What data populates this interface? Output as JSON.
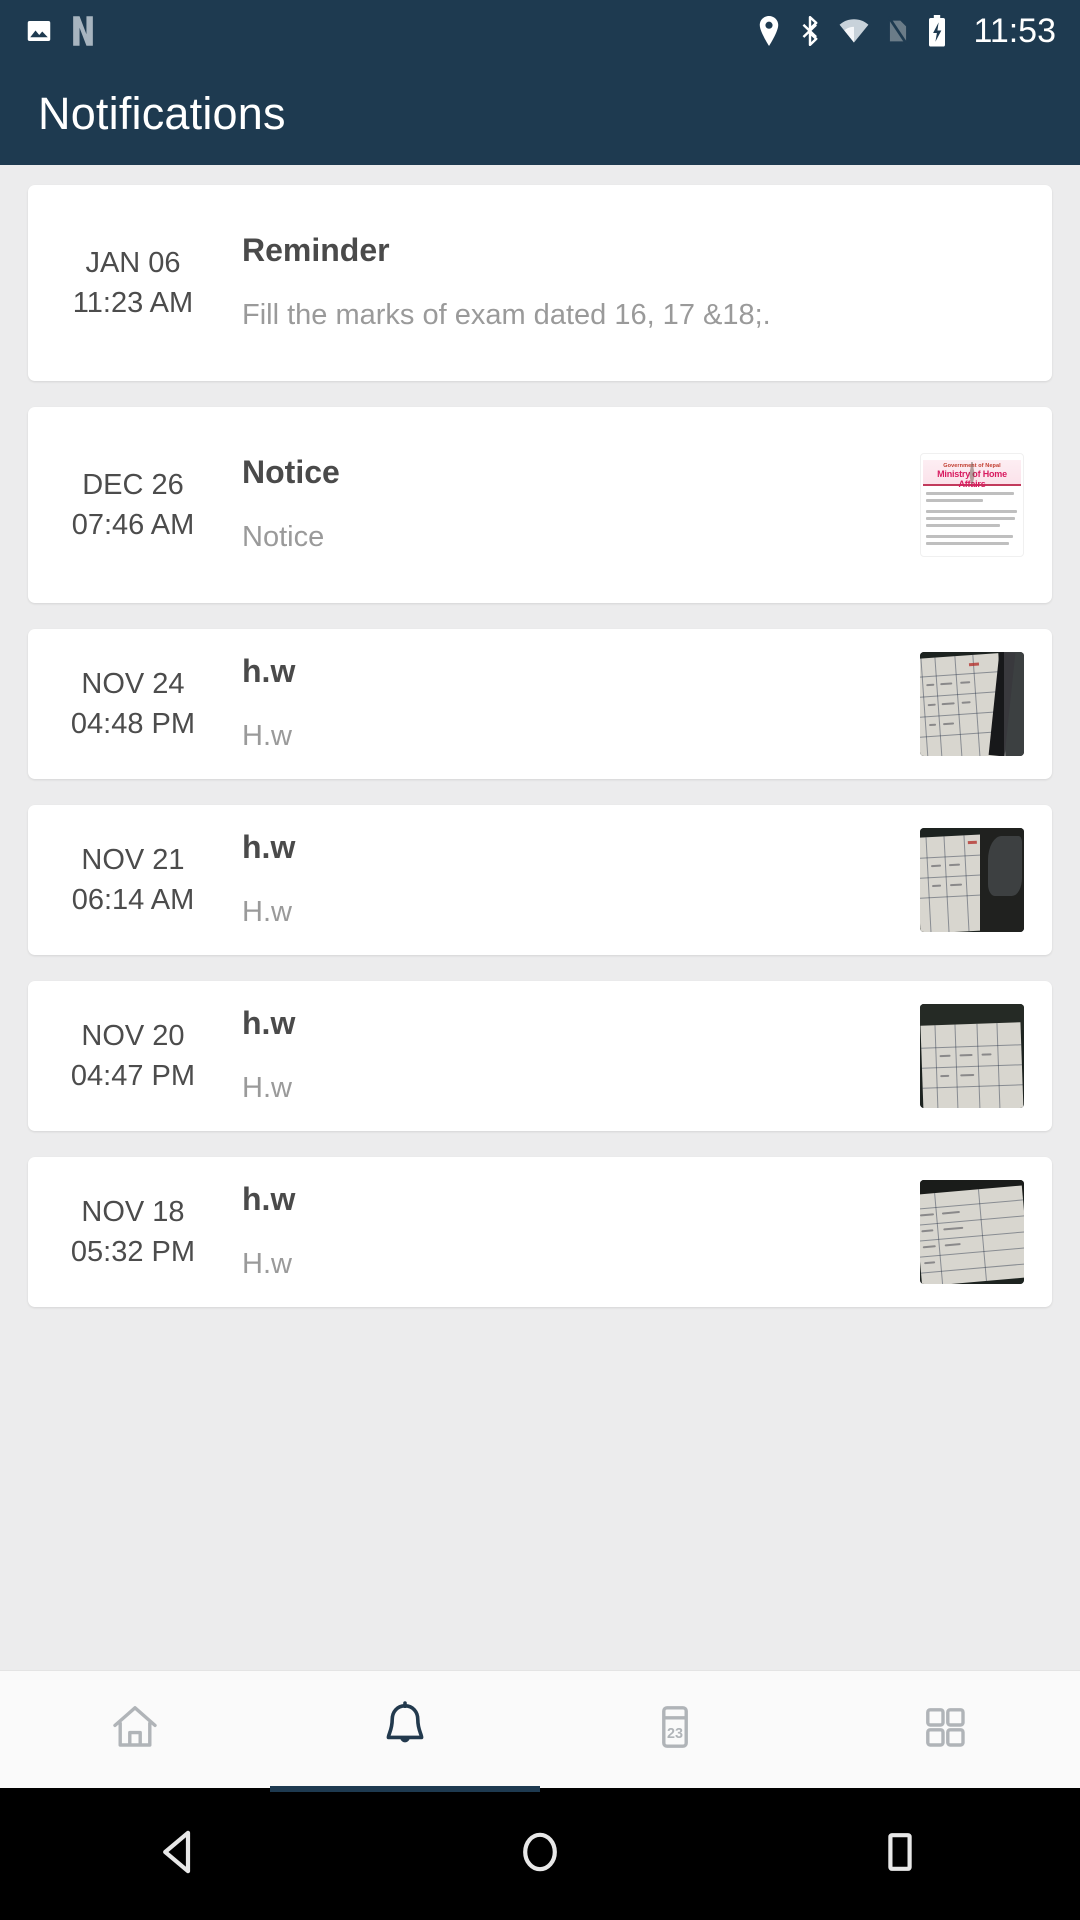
{
  "status_bar": {
    "time": "11:53",
    "left_icons": [
      "image-icon",
      "netflix-n-icon"
    ],
    "right_icons": [
      "location-icon",
      "bluetooth-icon",
      "wifi-icon",
      "sim-off-icon",
      "battery-charging-icon"
    ],
    "background_color": "#1e3a50"
  },
  "app_bar": {
    "title": "Notifications",
    "background_color": "#1e3a50",
    "text_color": "#ffffff"
  },
  "notifications": [
    {
      "date": "JAN 06",
      "time": "11:23 AM",
      "title": "Reminder",
      "body": "Fill the marks of exam dated 16, 17 &18;.",
      "has_thumbnail": false,
      "thumbnail_kind": ""
    },
    {
      "date": "DEC 26",
      "time": "07:46 AM",
      "title": "Notice",
      "body": "Notice",
      "has_thumbnail": true,
      "thumbnail_kind": "notice-document",
      "thumbnail_text": {
        "line1": "Government of Nepal",
        "line2": "Ministry of Home Affairs"
      }
    },
    {
      "date": "NOV 24",
      "time": "04:48 PM",
      "title": "h.w",
      "body": "H.w",
      "has_thumbnail": true,
      "thumbnail_kind": "notebook-photo-a"
    },
    {
      "date": "NOV 21",
      "time": "06:14 AM",
      "title": "h.w",
      "body": "H.w",
      "has_thumbnail": true,
      "thumbnail_kind": "notebook-photo-b"
    },
    {
      "date": "NOV 20",
      "time": "04:47 PM",
      "title": "h.w",
      "body": "H.w",
      "has_thumbnail": true,
      "thumbnail_kind": "notebook-photo-c"
    },
    {
      "date": "NOV 18",
      "time": "05:32 PM",
      "title": "h.w",
      "body": "H.w",
      "has_thumbnail": true,
      "thumbnail_kind": "notebook-photo-d"
    }
  ],
  "bottom_nav": {
    "active_index": 1,
    "active_color": "#1e3a50",
    "inactive_color": "#b0b4b8",
    "items": [
      {
        "icon": "home-icon",
        "label": ""
      },
      {
        "icon": "bell-icon",
        "label": ""
      },
      {
        "icon": "calendar-icon",
        "label": "",
        "badge": "23"
      },
      {
        "icon": "grid-icon",
        "label": ""
      }
    ]
  },
  "android_nav": {
    "background_color": "#000000",
    "buttons": [
      {
        "icon": "back-triangle-icon"
      },
      {
        "icon": "home-circle-icon"
      },
      {
        "icon": "recents-square-icon"
      }
    ]
  }
}
